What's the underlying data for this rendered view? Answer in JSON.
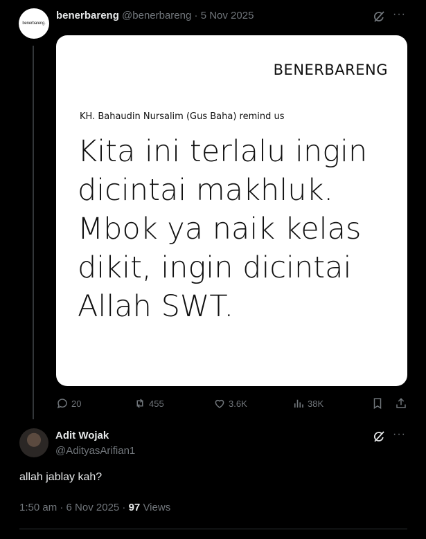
{
  "post": {
    "display_name": "benerbareng",
    "handle": "@benerbareng",
    "separator": "·",
    "date": "5 Nov 2025",
    "avatar_text": "benerbareng.",
    "more": "···",
    "image": {
      "brand": "BENERBARENG",
      "remind": "KH. Bahaudin Nursalim (Gus Baha) remind us",
      "quote_lines": [
        "Kita ini terlalu ingin",
        "dicintai makhluk.",
        "Mbok ya naik kelas",
        "dikit, ingin dicintai",
        "Allah SWT."
      ]
    },
    "actions": {
      "replies": "20",
      "reposts": "455",
      "likes": "3.6K",
      "views": "38K"
    }
  },
  "reply": {
    "display_name": "Adit Wojak",
    "handle": "@AdityasArifian1",
    "more": "···",
    "text": "allah jablay kah?",
    "time": "1:50 am · 6 Nov 2025 ·",
    "views_count": "97",
    "views_label": "Views"
  },
  "colors": {
    "background": "#000000",
    "muted": "#71767b",
    "text": "#e7e9ea"
  }
}
